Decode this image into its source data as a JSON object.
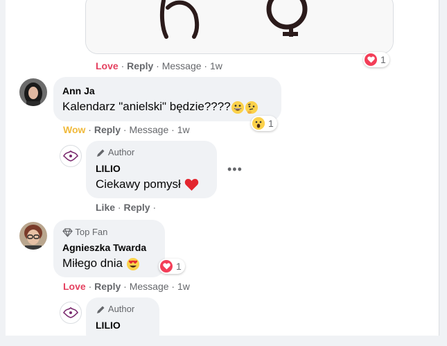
{
  "comments": [
    {
      "id": "c0",
      "actions": {
        "reaction": "Love",
        "reply": "Reply",
        "message": "Message",
        "time": "1w"
      },
      "reaction_count": "1"
    },
    {
      "id": "c1",
      "author": "Ann Ja",
      "text": "Kalendarz \"anielski\" będzie????",
      "actions": {
        "reaction": "Wow",
        "reply": "Reply",
        "message": "Message",
        "time": "1w"
      },
      "reaction_count": "1",
      "reply": {
        "badge": "Author",
        "author": "LILIO",
        "text": "Ciekawy pomysł",
        "actions": {
          "like": "Like",
          "reply": "Reply"
        },
        "more": "•••"
      }
    },
    {
      "id": "c2",
      "badge": "Top Fan",
      "author": "Agnieszka Twarda",
      "text": "Miłego dnia",
      "reaction_count": "1",
      "actions": {
        "reaction": "Love",
        "reply": "Reply",
        "message": "Message",
        "time": "1w"
      },
      "reply": {
        "badge": "Author",
        "author": "LILIO"
      }
    }
  ],
  "separator": "·",
  "colors": {
    "love": "#e4405f",
    "wow": "#f0b93a",
    "muted": "#65676b",
    "bubble": "#f0f2f5"
  },
  "icons": [
    "heart-icon",
    "wow-face-icon",
    "pencil-icon",
    "diamond-icon",
    "grin-emoji-icon",
    "thinking-emoji-icon",
    "red-heart-emoji-icon",
    "heart-eyes-emoji-icon"
  ]
}
